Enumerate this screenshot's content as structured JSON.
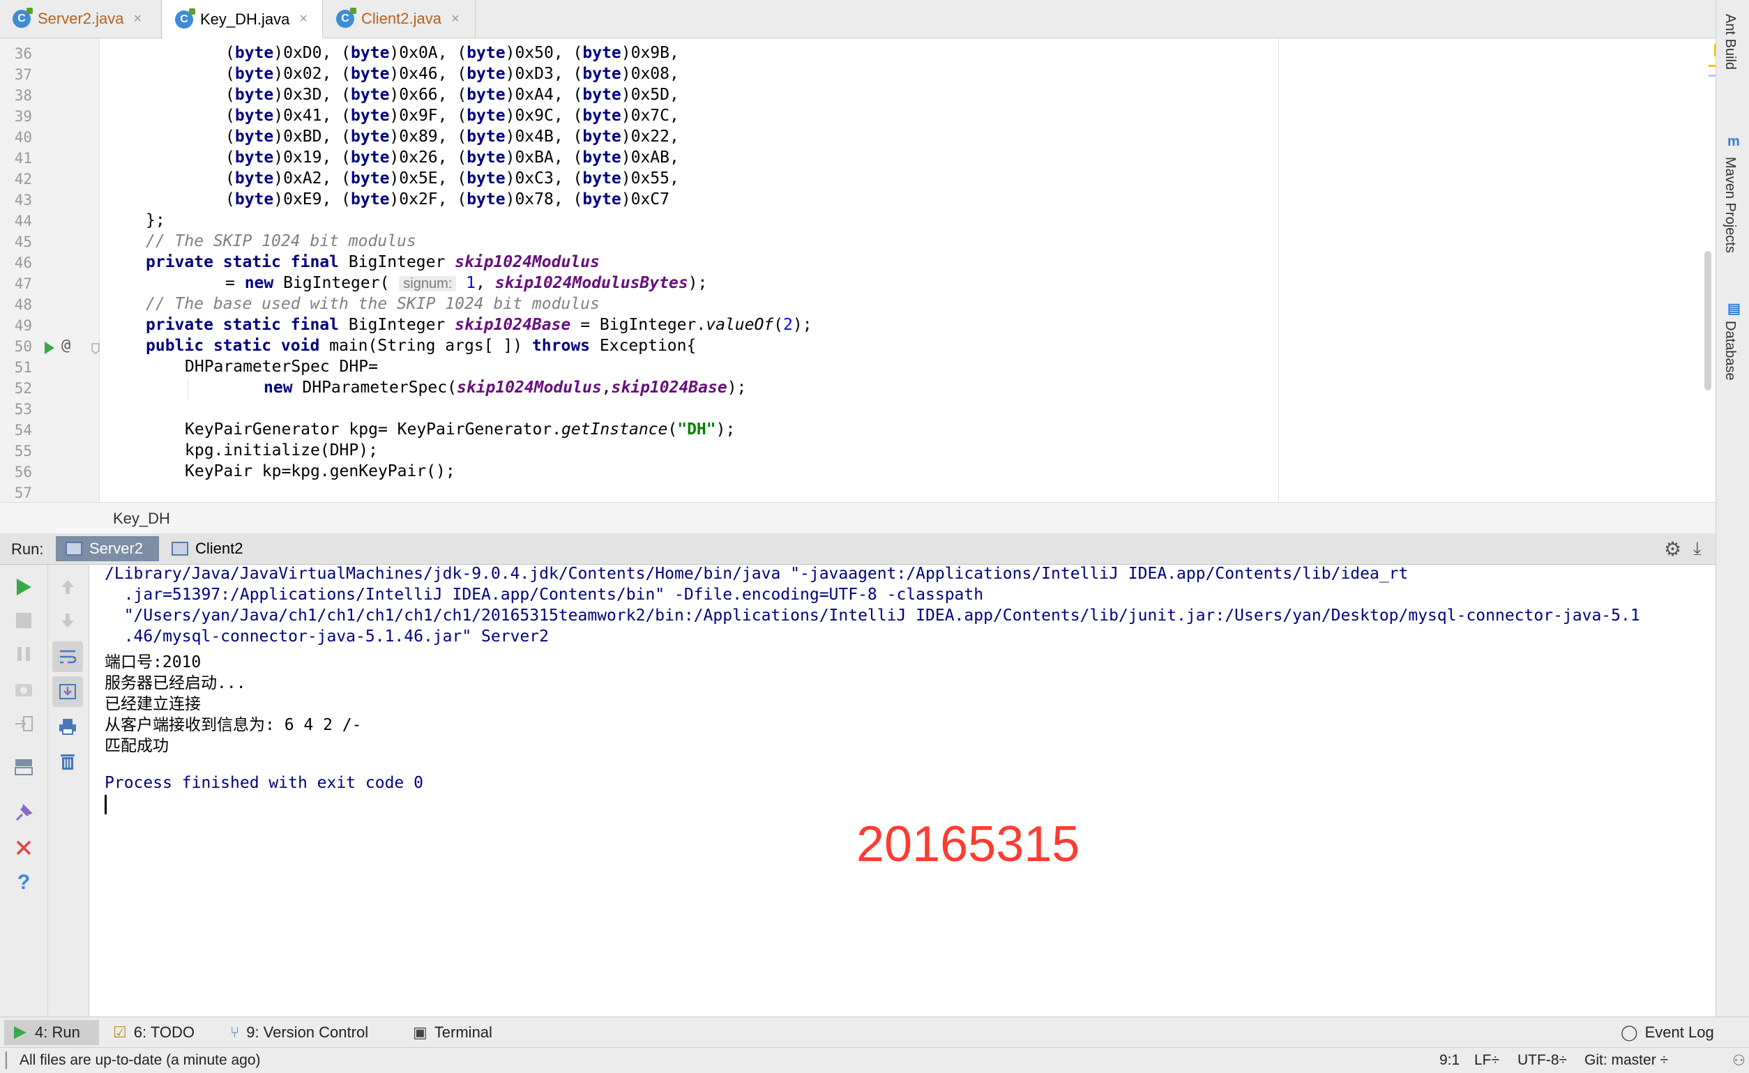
{
  "tabs": [
    {
      "label": "Server2.java",
      "active": false
    },
    {
      "label": "Key_DH.java",
      "active": true
    },
    {
      "label": "Client2.java",
      "active": false
    }
  ],
  "file_icon_letter": "C",
  "tab_close": "×",
  "editor": {
    "lines": [
      {
        "n": "36",
        "c": "(byte)0xD0, (byte)0x0A, (byte)0x50, (byte)0x9B,"
      },
      {
        "n": "37",
        "c": "(byte)0x02, (byte)0x46, (byte)0xD3, (byte)0x08,"
      },
      {
        "n": "38",
        "c": "(byte)0x3D, (byte)0x66, (byte)0xA4, (byte)0x5D,"
      },
      {
        "n": "39",
        "c": "(byte)0x41, (byte)0x9F, (byte)0x9C, (byte)0x7C,"
      },
      {
        "n": "40",
        "c": "(byte)0xBD, (byte)0x89, (byte)0x4B, (byte)0x22,"
      },
      {
        "n": "41",
        "c": "(byte)0x19, (byte)0x26, (byte)0xBA, (byte)0xAB,"
      },
      {
        "n": "42",
        "c": "(byte)0xA2, (byte)0x5E, (byte)0xC3, (byte)0x55,"
      },
      {
        "n": "43",
        "c": "(byte)0xE9, (byte)0x2F, (byte)0x78, (byte)0xC7"
      },
      {
        "n": "44",
        "c": "};"
      },
      {
        "n": "45",
        "c": "// The SKIP 1024 bit modulus"
      },
      {
        "n": "46",
        "c": "private static final BigInteger skip1024Modulus"
      },
      {
        "n": "47",
        "c": "= new BigInteger( signum: 1, skip1024ModulusBytes);"
      },
      {
        "n": "48",
        "c": "// The base used with the SKIP 1024 bit modulus"
      },
      {
        "n": "49",
        "c": "private static final BigInteger skip1024Base = BigInteger.valueOf(2);"
      },
      {
        "n": "50",
        "c": "public static void main(String args[ ]) throws Exception{"
      },
      {
        "n": "51",
        "c": "DHParameterSpec DHP="
      },
      {
        "n": "52",
        "c": "new DHParameterSpec(skip1024Modulus,skip1024Base);"
      },
      {
        "n": "53",
        "c": ""
      },
      {
        "n": "54",
        "c": "KeyPairGenerator kpg= KeyPairGenerator.getInstance(\"DH\");"
      },
      {
        "n": "55",
        "c": "kpg.initialize(DHP);"
      },
      {
        "n": "56",
        "c": "KeyPair kp=kpg.genKeyPair();"
      },
      {
        "n": "57",
        "c": ""
      }
    ]
  },
  "breadcrumb": "Key_DH",
  "run": {
    "label": "Run:",
    "tabs": [
      "Server2",
      "Client2"
    ]
  },
  "console": {
    "lines": [
      "/Library/Java/JavaVirtualMachines/jdk-9.0.4.jdk/Contents/Home/bin/java \"-javaagent:/Applications/IntelliJ IDEA.app/Contents/lib/idea_rt",
      "  .jar=51397:/Applications/IntelliJ IDEA.app/Contents/bin\" -Dfile.encoding=UTF-8 -classpath",
      "  \"/Users/yan/Java/ch1/ch1/ch1/ch1/ch1/20165315teamwork2/bin:/Applications/IntelliJ IDEA.app/Contents/lib/junit.jar:/Users/yan/Desktop/mysql-connector-java-5.1",
      "  .46/mysql-connector-java-5.1.46.jar\" Server2",
      "端口号:2010",
      "服务器已经启动...",
      "已经建立连接",
      "从客户端接收到信息为: 6 4 2 /-",
      "匹配成功",
      "",
      "Process finished with exit code 0"
    ],
    "watermark": "20165315"
  },
  "right_tools": [
    "Ant Build",
    "Maven Projects",
    "Database"
  ],
  "bottom_tools": [
    {
      "label": "4: Run",
      "icon": "run-icon"
    },
    {
      "label": "6: TODO",
      "icon": "todo-icon"
    },
    {
      "label": "9: Version Control",
      "icon": "version-control-icon"
    },
    {
      "label": "Terminal",
      "icon": "terminal-icon"
    }
  ],
  "event_log": "Event Log",
  "status": {
    "message": "All files are up-to-date (a minute ago)",
    "position": "9:1",
    "line_sep": "LF÷",
    "encoding": "UTF-8÷",
    "git": "Git: master ÷"
  },
  "colors": {
    "keyword": "#000080",
    "field": "#660e7a",
    "number": "#0000ff",
    "string": "#008000",
    "comment": "#808080",
    "watermark": "#ff3b30"
  }
}
